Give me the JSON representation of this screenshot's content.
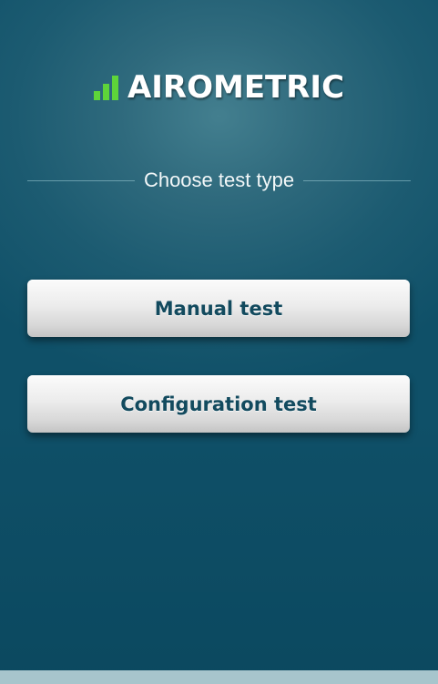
{
  "header": {
    "app_name": "AIROMETRIC",
    "logo_icon": "signal-bars-icon"
  },
  "section": {
    "title": "Choose test type"
  },
  "buttons": {
    "manual": "Manual test",
    "configuration": "Configuration test"
  },
  "colors": {
    "accent_green": "#5ed43a",
    "button_text": "#124a5e",
    "background": "#1c5b71",
    "bottom_bar": "#a7c5cc"
  }
}
